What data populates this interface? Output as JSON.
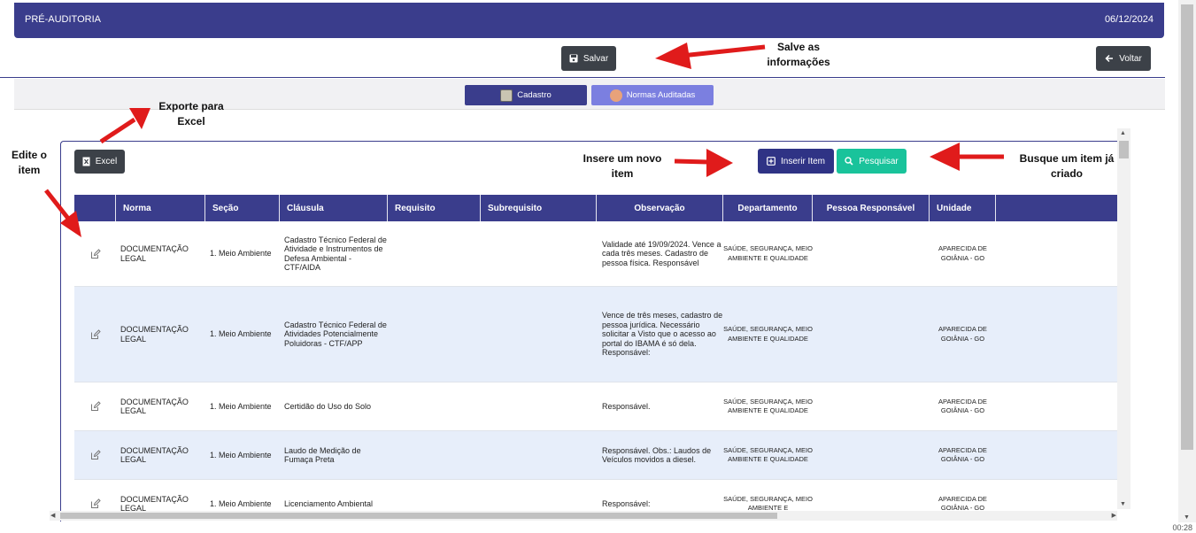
{
  "header": {
    "title": "PRÉ-AUDITORIA",
    "date": "06/12/2024"
  },
  "toolbar": {
    "save_label": "Salvar",
    "back_label": "Voltar"
  },
  "tabs": [
    {
      "label": "Cadastro"
    },
    {
      "label": "Normas Auditadas"
    }
  ],
  "panel": {
    "excel_label": "Excel",
    "insert_label": "Inserir Item",
    "search_label": "Pesquisar"
  },
  "table": {
    "headers": [
      "Norma",
      "Seção",
      "Cláusula",
      "Requisito",
      "Subrequisito",
      "Observação",
      "Departamento",
      "Pessoa Responsável",
      "Unidade"
    ],
    "rows": [
      {
        "norma": "DOCUMENTAÇÃO LEGAL",
        "secao": "1. Meio Ambiente",
        "clausula": "Cadastro Técnico Federal de Atividade e Instrumentos de Defesa Ambiental - CTF/AIDA",
        "requisito": "",
        "subrequisito": "",
        "observacao": "Validade até 19/09/2024. Vence a cada três meses. Cadastro de pessoa física. Responsável",
        "departamento": "SAÚDE, SEGURANÇA, MEIO AMBIENTE E QUALIDADE",
        "pessoa": "",
        "unidade": "APARECIDA DE GOIÂNIA - GO"
      },
      {
        "norma": "DOCUMENTAÇÃO LEGAL",
        "secao": "1. Meio Ambiente",
        "clausula": "Cadastro Técnico Federal de Atividades Potencialmente Poluidoras - CTF/APP",
        "requisito": "",
        "subrequisito": "",
        "observacao": "Vence de três meses, cadastro de pessoa jurídica. Necessário solicitar a Visto que o acesso ao portal do IBAMA é só dela. Responsável:",
        "departamento": "SAÚDE, SEGURANÇA, MEIO AMBIENTE E QUALIDADE",
        "pessoa": "",
        "unidade": "APARECIDA DE GOIÂNIA - GO"
      },
      {
        "norma": "DOCUMENTAÇÃO LEGAL",
        "secao": "1. Meio Ambiente",
        "clausula": "Certidão do Uso do Solo",
        "requisito": "",
        "subrequisito": "",
        "observacao": "Responsável.",
        "departamento": "SAÚDE, SEGURANÇA, MEIO AMBIENTE E QUALIDADE",
        "pessoa": "",
        "unidade": "APARECIDA DE GOIÂNIA - GO"
      },
      {
        "norma": "DOCUMENTAÇÃO LEGAL",
        "secao": "1. Meio Ambiente",
        "clausula": "Laudo de Medição de Fumaça Preta",
        "requisito": "",
        "subrequisito": "",
        "observacao": "Responsável. Obs.: Laudos de Veículos movidos a diesel.",
        "departamento": "SAÚDE, SEGURANÇA, MEIO AMBIENTE E QUALIDADE",
        "pessoa": "",
        "unidade": "APARECIDA DE GOIÂNIA - GO"
      },
      {
        "norma": "DOCUMENTAÇÃO LEGAL",
        "secao": "1. Meio Ambiente",
        "clausula": "Licenciamento Ambiental",
        "requisito": "",
        "subrequisito": "",
        "observacao": "Responsável:",
        "departamento": "SAÚDE, SEGURANÇA, MEIO AMBIENTE E",
        "pessoa": "",
        "unidade": "APARECIDA DE GOIÂNIA - GO"
      }
    ]
  },
  "annotations": {
    "save": "Salve as informações",
    "export": "Exporte para Excel",
    "edit": "Edite o item",
    "insert": "Insere um novo item",
    "search": "Busque um item já criado"
  },
  "timestamp": "00:28",
  "colors": {
    "primary": "#3a3d8c",
    "tab_secondary": "#7b7fe0",
    "search": "#19c39b",
    "row_alt": "#e7eefa",
    "arrow": "#e01b1b"
  }
}
